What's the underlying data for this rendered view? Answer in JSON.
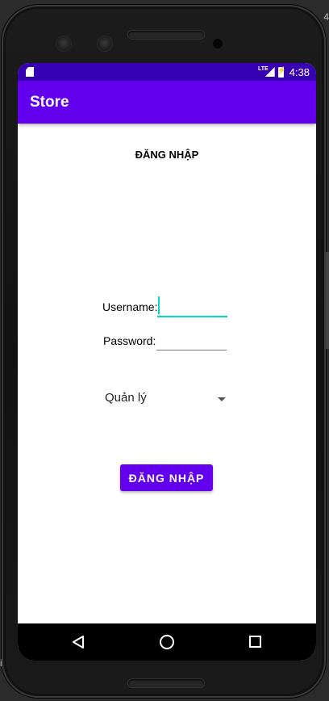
{
  "status_bar": {
    "network_label": "LTE",
    "time": "4:38",
    "icons": [
      "sd-card-icon",
      "signal-icon",
      "battery-charging-icon"
    ]
  },
  "app_bar": {
    "title": "Store"
  },
  "login": {
    "heading": "ĐĂNG NHẬP",
    "username_label": "Username:",
    "username_value": "",
    "password_label": "Password:",
    "password_value": "",
    "role_selected": "Quản lý",
    "submit_label": "ĐĂNG NHẬP"
  },
  "nav_bar": {
    "icons": [
      "back-icon",
      "home-icon",
      "recents-icon"
    ]
  },
  "edge_text": {
    "right": "4",
    "left": "i"
  },
  "colors": {
    "status_bar": "#3700B3",
    "app_bar": "#6200EE",
    "accent": "#03DAC5",
    "button": "#6200EE"
  }
}
